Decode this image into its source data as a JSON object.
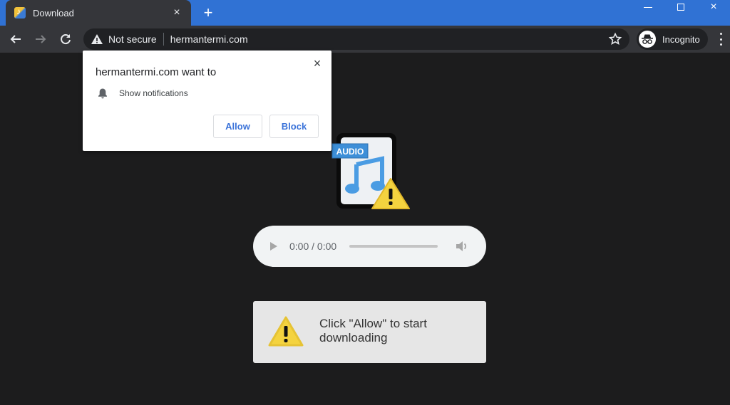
{
  "browser": {
    "tab": {
      "title": "Download",
      "favicon": "audio-favicon-icon",
      "close_icon": "×"
    },
    "new_tab_icon": "+",
    "window_controls": {
      "minimize": "minimize-icon",
      "maximize": "maximize-icon",
      "close": "×"
    },
    "toolbar": {
      "back_icon": "arrow-left-icon",
      "forward_icon": "arrow-right-icon",
      "reload_icon": "reload-icon",
      "security_label": "Not secure",
      "url": "hermantermi.com",
      "bookmark_icon": "star-icon",
      "profile_label": "Incognito",
      "menu_icon": "kebab-menu-icon"
    }
  },
  "permission_prompt": {
    "title": "hermantermi.com want to",
    "close_icon": "×",
    "permission": "Show notifications",
    "allow_label": "Allow",
    "block_label": "Block"
  },
  "page": {
    "audio_badge": "AUDIO",
    "player": {
      "time": "0:00 / 0:00",
      "progress": 0
    },
    "notice_text": "Click \"Allow\" to start downloading"
  },
  "colors": {
    "titlebar": "#3072d4",
    "toolbar": "#35363a",
    "page_bg": "#1c1c1d",
    "accent_button_text": "#3b73d9",
    "warning_yellow": "#f4d33f"
  }
}
